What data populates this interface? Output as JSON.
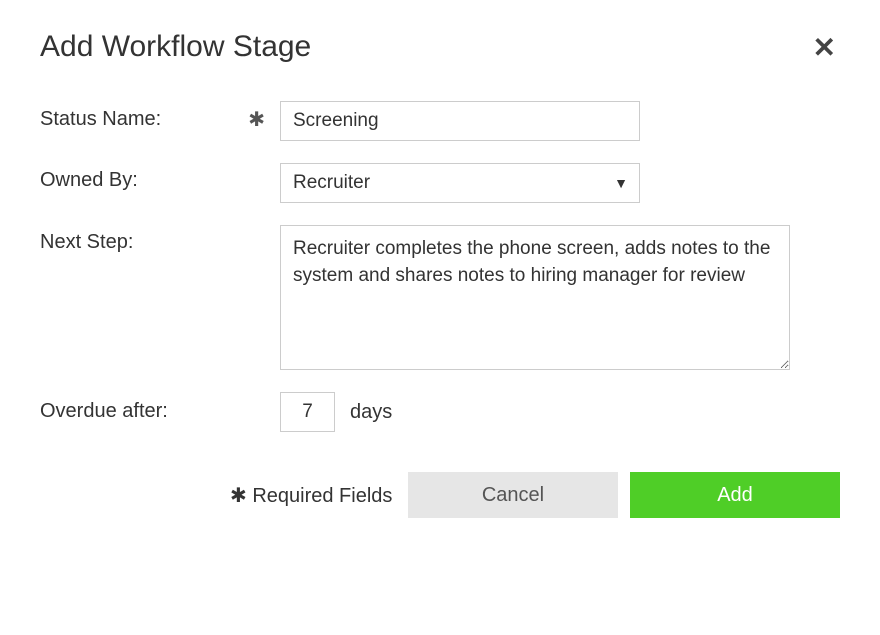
{
  "dialog": {
    "title": "Add Workflow Stage",
    "fields": {
      "status_name": {
        "label": "Status Name:",
        "value": "Screening",
        "required_mark": "✱"
      },
      "owned_by": {
        "label": "Owned By:",
        "value": "Recruiter"
      },
      "next_step": {
        "label": "Next Step:",
        "value": "Recruiter completes the phone screen, adds notes to the system and shares notes to hiring manager for review"
      },
      "overdue_after": {
        "label": "Overdue after:",
        "value": "7",
        "unit": "days"
      }
    },
    "footer": {
      "required_note": "✱ Required Fields",
      "cancel_label": "Cancel",
      "add_label": "Add"
    }
  }
}
